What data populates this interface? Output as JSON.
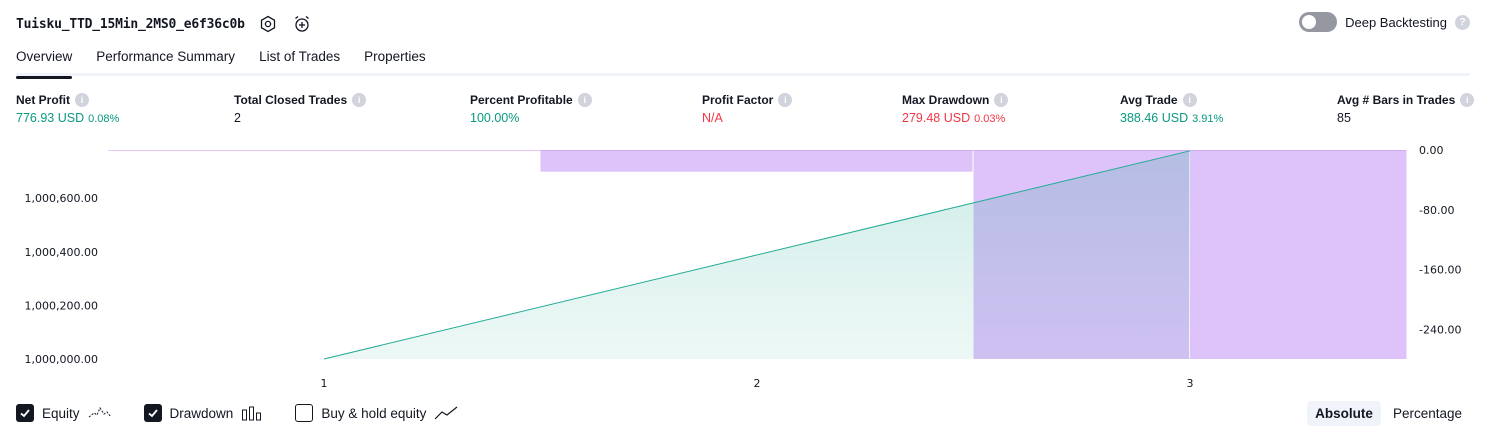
{
  "header": {
    "strategy_name": "Tuisku_TTD_15Min_2MS0_e6f36c0b",
    "settings_icon": "gear-icon",
    "alert_icon": "alarm-clock-plus-icon",
    "deep_backtesting_label": "Deep Backtesting",
    "deep_backtesting_on": false,
    "help_glyph": "?"
  },
  "tabs": [
    {
      "label": "Overview",
      "active": true
    },
    {
      "label": "Performance Summary",
      "active": false
    },
    {
      "label": "List of Trades",
      "active": false
    },
    {
      "label": "Properties",
      "active": false
    }
  ],
  "metrics": {
    "net_profit": {
      "label": "Net Profit",
      "value": "776.93 USD",
      "pct": "0.08%"
    },
    "total_closed_trades": {
      "label": "Total Closed Trades",
      "value": "2"
    },
    "percent_profitable": {
      "label": "Percent Profitable",
      "value": "100.00%"
    },
    "profit_factor": {
      "label": "Profit Factor",
      "value": "N/A"
    },
    "max_drawdown": {
      "label": "Max Drawdown",
      "value": "279.48 USD",
      "pct": "0.03%"
    },
    "avg_trade": {
      "label": "Avg Trade",
      "value": "388.46 USD",
      "pct": "3.91%"
    },
    "avg_bars": {
      "label": "Avg # Bars in Trades",
      "value": "85"
    },
    "info_glyph": "i"
  },
  "chart_data": {
    "type": "line",
    "x_ticks": [
      "1",
      "2",
      "3"
    ],
    "equity": {
      "x": [
        1,
        3
      ],
      "y": [
        1000000,
        1000776.93
      ]
    },
    "drawdown_bars": [
      {
        "from": 0.5,
        "to": 1.5,
        "value": 0
      },
      {
        "from": 1.5,
        "to": 2.5,
        "value": -29
      },
      {
        "from": 2.5,
        "to": 3.0,
        "value": -279.48
      },
      {
        "from": 3.0,
        "to": 3.5,
        "value": -279.48
      }
    ],
    "left_axis": {
      "ylim": [
        1000000,
        1000780
      ],
      "ticks": [
        "1,000,000.00",
        "1,000,200.00",
        "1,000,400.00",
        "1,000,600.00"
      ]
    },
    "right_axis": {
      "ylim": [
        -279.48,
        0
      ],
      "ticks": [
        "0.00",
        "-80.00",
        "-160.00",
        "-240.00"
      ]
    },
    "colors": {
      "equity_line": "#22ab94",
      "equity_fill": "#22ab94",
      "drawdown": "#c89bf7"
    }
  },
  "legend": [
    {
      "label": "Equity",
      "checked": true,
      "icon": "equity-line-icon"
    },
    {
      "label": "Drawdown",
      "checked": true,
      "icon": "drawdown-bars-icon"
    },
    {
      "label": "Buy & hold equity",
      "checked": false,
      "icon": "buy-hold-line-icon"
    }
  ],
  "mode": {
    "absolute": "Absolute",
    "percentage": "Percentage",
    "selected": "Absolute"
  }
}
